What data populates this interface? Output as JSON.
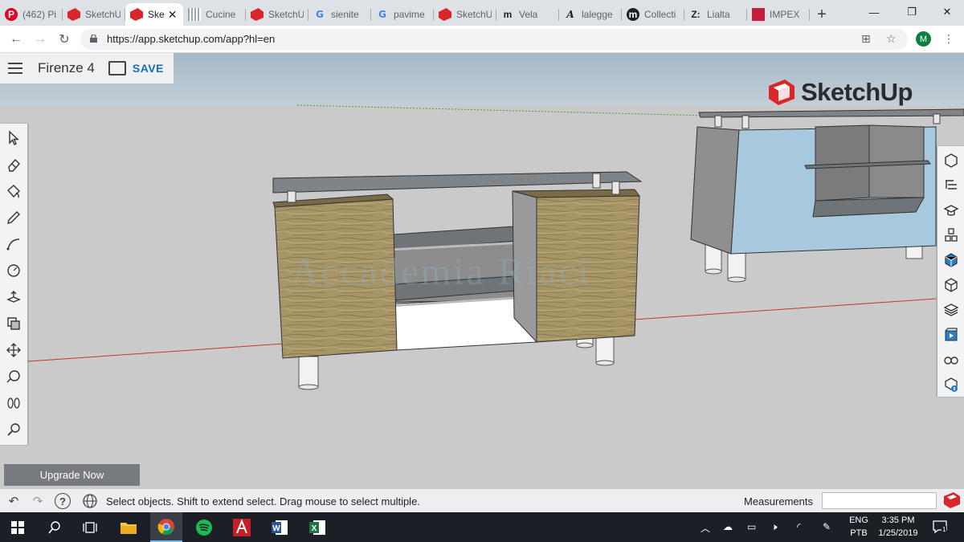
{
  "browser": {
    "tabs": [
      {
        "favicon": "pinterest-icon",
        "label": "(462) Pi"
      },
      {
        "favicon": "sketchup-icon",
        "label": "SketchU"
      },
      {
        "favicon": "sketchup-icon",
        "label": "Ske"
      },
      {
        "favicon": "grid-icon",
        "label": "Cucine"
      },
      {
        "favicon": "sketchup-icon",
        "label": "SketchU"
      },
      {
        "favicon": "google-icon",
        "label": "sienite"
      },
      {
        "favicon": "google-icon",
        "label": "pavime"
      },
      {
        "favicon": "sketchup-icon",
        "label": "SketchU"
      },
      {
        "favicon": "m-logo-icon",
        "label": "Vela"
      },
      {
        "favicon": "a-logo-icon",
        "label": "lalegge"
      },
      {
        "favicon": "collect-icon",
        "label": "Collecti"
      },
      {
        "favicon": "z-logo-icon",
        "label": "Lialta"
      },
      {
        "favicon": "impex-icon",
        "label": "IMPEX"
      }
    ],
    "url": "https://app.sketchup.com/app?hl=en",
    "profile_initial": "M"
  },
  "app": {
    "project_name": "Firenze 4",
    "save_label": "SAVE",
    "logo_text": "SketchUp",
    "watermark": "Accademia Riaci",
    "upgrade_label": "Upgrade Now",
    "left_tools": [
      "select-icon",
      "eraser-icon",
      "paint-bucket-icon",
      "pencil-icon",
      "arc-icon",
      "circle-icon",
      "push-pull-icon",
      "offset-icon",
      "move-icon",
      "tape-measure-icon",
      "walk-icon",
      "search-icon"
    ],
    "right_panels": [
      "entity-info-icon",
      "outliner-icon",
      "instructor-icon",
      "components-icon",
      "materials-icon",
      "styles-icon",
      "layers-icon",
      "scenes-icon",
      "display-icon",
      "model-info-icon"
    ]
  },
  "status": {
    "hint": "Select objects. Shift to extend select. Drag mouse to select multiple.",
    "measurements_label": "Measurements",
    "measurements_value": ""
  },
  "taskbar": {
    "apps": [
      "windows-start-icon",
      "search-icon",
      "task-view-icon",
      "file-explorer-icon",
      "chrome-icon",
      "spotify-icon",
      "autocad-icon",
      "word-icon",
      "excel-icon"
    ],
    "language": "ENG",
    "layout": "PTB",
    "time": "3:35 PM",
    "date": "1/25/2019",
    "notification_count": "1"
  },
  "colors": {
    "sketchup_red": "#d8262b",
    "save_blue": "#1c6bb5",
    "wood": "#a79567",
    "glass": "#6f7478",
    "cabinet_blue": "#a8c9dd"
  }
}
